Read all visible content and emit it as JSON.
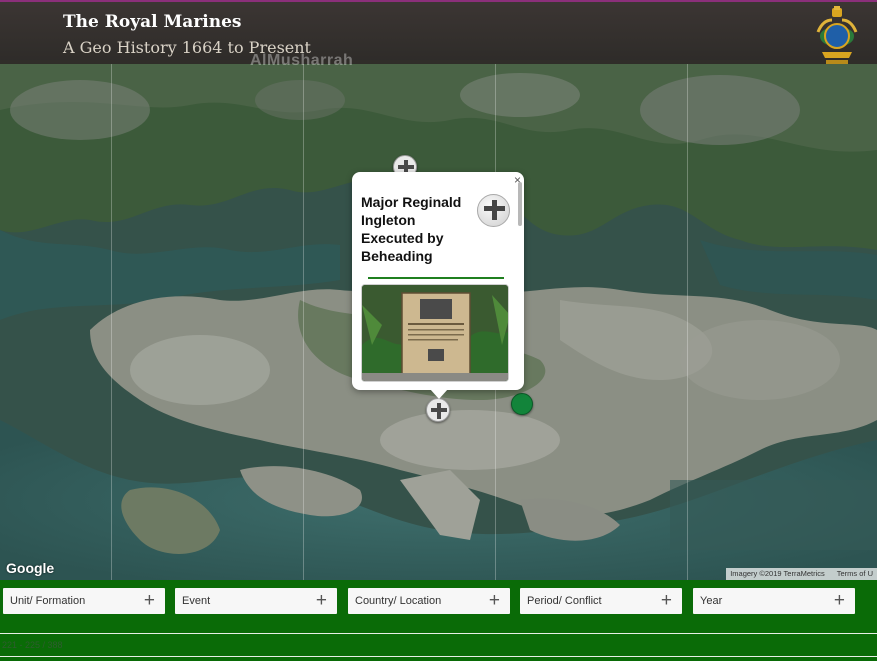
{
  "header": {
    "title": "The Royal Marines",
    "subtitle": "A Geo History 1664 to Present",
    "map_place_label": "AlMusharrah"
  },
  "info_window": {
    "title": "Major Reginald Ingleton Executed by Beheading",
    "close_glyph": "×"
  },
  "map": {
    "provider_logo": "Google",
    "attribution": {
      "imagery": "Imagery ©2019 TerraMetrics",
      "terms": "Terms of U"
    }
  },
  "filters": [
    {
      "label": "Unit/ Formation",
      "icon": "+"
    },
    {
      "label": "Event",
      "icon": "+"
    },
    {
      "label": "Country/ Location",
      "icon": "+"
    },
    {
      "label": "Period/ Conflict",
      "icon": "+"
    },
    {
      "label": "Year",
      "icon": "+"
    }
  ],
  "results_count": "221 - 225 / 388",
  "colors": {
    "filter_bar": "#0a6b07",
    "header_bg": "#3c3432",
    "accent_rule": "#1f7f1f"
  }
}
